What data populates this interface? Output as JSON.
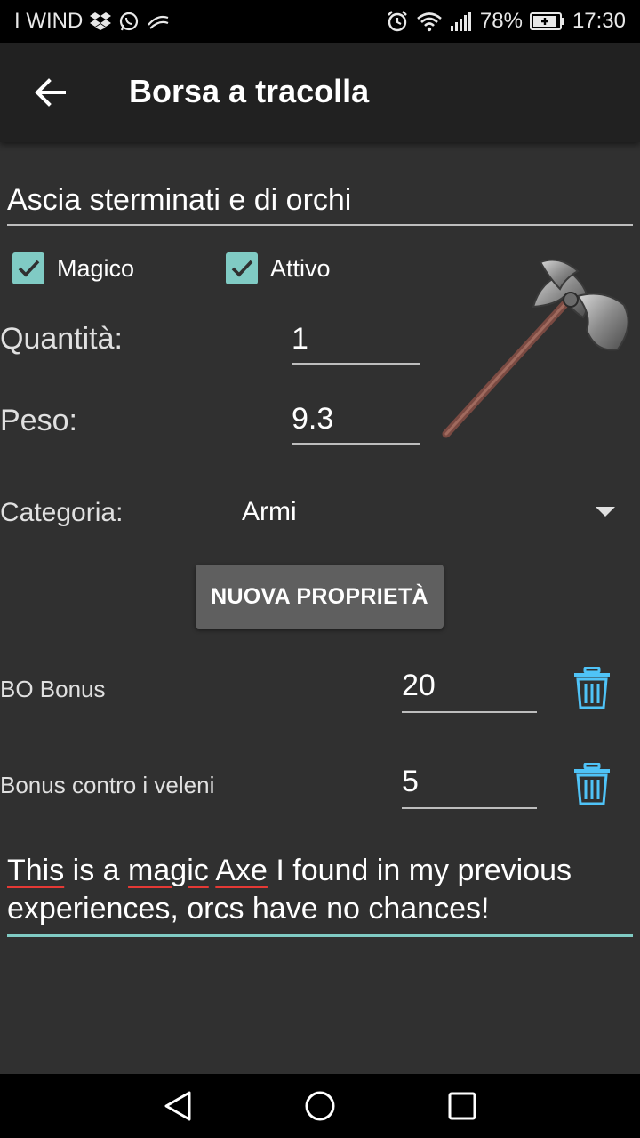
{
  "status_bar": {
    "carrier": "I WIND",
    "battery": "78%",
    "time": "17:30"
  },
  "app_bar": {
    "title": "Borsa a tracolla"
  },
  "item": {
    "name": "Ascia sterminati e di orchi",
    "magic_label": "Magico",
    "magic_checked": true,
    "active_label": "Attivo",
    "active_checked": true,
    "quantity_label": "Quantità:",
    "quantity_value": "1",
    "weight_label": "Peso:",
    "weight_value": "9.3",
    "category_label": "Categoria:",
    "category_value": "Armi",
    "image_icon": "battle-axe-image"
  },
  "actions": {
    "new_property_label": "NUOVA PROPRIETÀ"
  },
  "properties": [
    {
      "label": "BO Bonus",
      "value": "20"
    },
    {
      "label": "Bonus contro i veleni",
      "value": "5"
    }
  ],
  "notes": {
    "w1": "This",
    "w2": " is a ",
    "w3": "magic",
    "w4": " ",
    "w5": "Axe",
    "w6": " I found in my previous experiences, orcs have no chances!"
  },
  "colors": {
    "background": "#303030",
    "app_bar": "#212121",
    "accent": "#80cbc4",
    "trash": "#4fc3f7",
    "button": "#5f5f5f"
  },
  "nav_bar": {
    "icons": [
      "back-triangle-icon",
      "home-circle-icon",
      "recents-square-icon"
    ]
  }
}
